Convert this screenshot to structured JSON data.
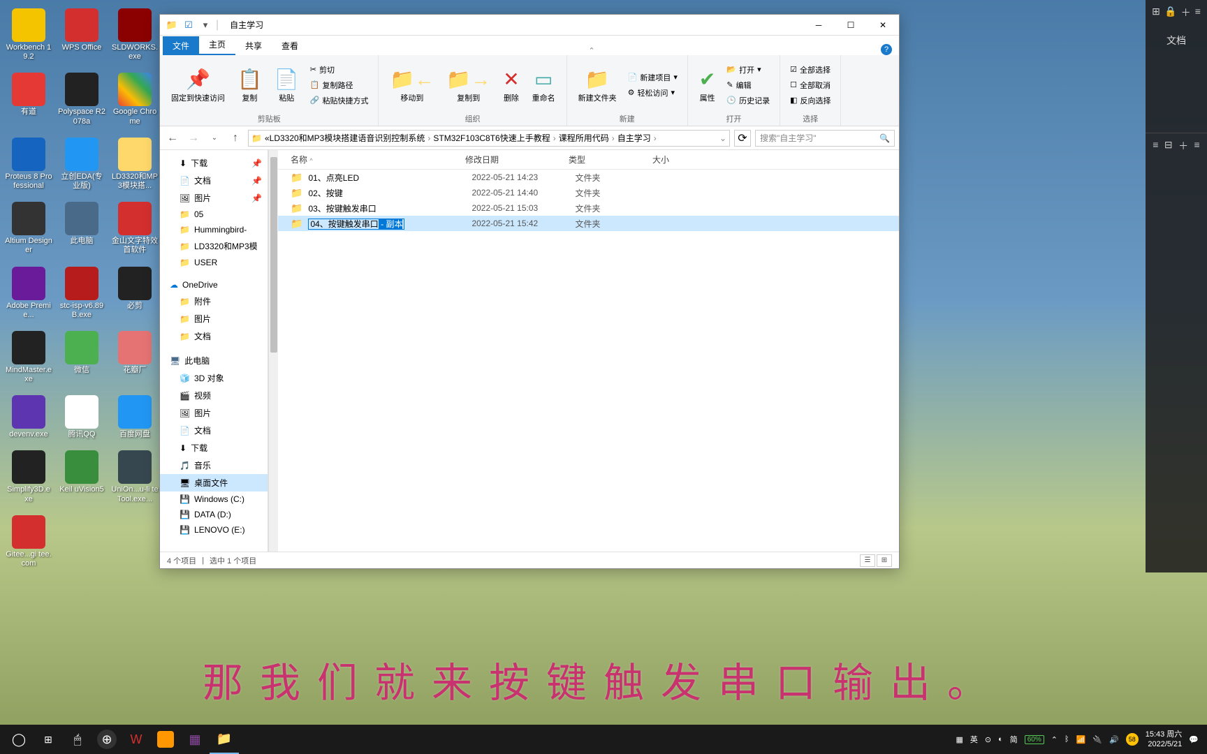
{
  "desktop": {
    "icons": [
      {
        "label": "Workbench 19.2",
        "bg": "#f5c400"
      },
      {
        "label": "WPS Office",
        "bg": "#d32f2f"
      },
      {
        "label": "SLDWORKS.exe",
        "bg": "#8b0000"
      },
      {
        "label": "有道",
        "bg": "#e53935"
      },
      {
        "label": "Polyspace R2078a",
        "bg": "#222"
      },
      {
        "label": "Google Chrome",
        "bg": "linear-gradient(45deg,#ea4335,#fbbc05,#34a853,#4285f4)"
      },
      {
        "label": "Proteus 8 Professional",
        "bg": "#1565c0"
      },
      {
        "label": "立创EDA(专业版)",
        "bg": "#2196f3"
      },
      {
        "label": "LD3320和MP3模块搭...",
        "bg": "#ffd86b"
      },
      {
        "label": "Altium Designer",
        "bg": "#333"
      },
      {
        "label": "此电脑",
        "bg": "#4a6a8a"
      },
      {
        "label": "金山文字特效首软件",
        "bg": "#d32f2f"
      },
      {
        "label": "Adobe Premie...",
        "bg": "#6a1b9a"
      },
      {
        "label": "stc-isp-v6.89B.exe",
        "bg": "#b71c1c"
      },
      {
        "label": "必剪",
        "bg": "#222"
      },
      {
        "label": "MindMaster.exe",
        "bg": "#222"
      },
      {
        "label": "微信",
        "bg": "#4caf50"
      },
      {
        "label": "花瓣厂",
        "bg": "#e57373"
      },
      {
        "label": "devenv.exe",
        "bg": "#5e35b1"
      },
      {
        "label": "腾讯QQ",
        "bg": "#fff"
      },
      {
        "label": "百度网盘",
        "bg": "#2196f3"
      },
      {
        "label": "Simplify3D.e xe",
        "bg": "#222"
      },
      {
        "label": "Keil uVision5",
        "bg": "#388e3c"
      },
      {
        "label": "UniOn...u-li teTool.exe...",
        "bg": "#37474f"
      },
      {
        "label": "Gitee...gi tee.com",
        "bg": "#d32f2f"
      }
    ]
  },
  "explorer": {
    "title": "自主学习",
    "tabs": {
      "file": "文件",
      "home": "主页",
      "share": "共享",
      "view": "查看"
    },
    "ribbon": {
      "clipboard": {
        "label": "剪贴板",
        "pin": "固定到快速访问",
        "copy": "复制",
        "paste": "粘贴",
        "cut": "剪切",
        "copypath": "复制路径",
        "pasteshortcut": "粘贴快捷方式"
      },
      "organize": {
        "label": "组织",
        "moveto": "移动到",
        "copyto": "复制到",
        "delete": "删除",
        "rename": "重命名"
      },
      "new": {
        "label": "新建",
        "newfolder": "新建文件夹",
        "newitem": "新建项目",
        "easyaccess": "轻松访问"
      },
      "open": {
        "label": "打开",
        "properties": "属性",
        "open": "打开",
        "edit": "编辑",
        "history": "历史记录"
      },
      "select": {
        "label": "选择",
        "selectall": "全部选择",
        "selectnone": "全部取消",
        "invert": "反向选择"
      }
    },
    "breadcrumb": [
      "LD3320和MP3模块搭建语音识别控制系统",
      "STM32F103C8T6快速上手教程",
      "课程所用代码",
      "自主学习"
    ],
    "search_placeholder": "搜索\"自主学习\"",
    "columns": {
      "name": "名称",
      "date": "修改日期",
      "type": "类型",
      "size": "大小"
    },
    "sidebar": {
      "quick": [
        {
          "label": "下载",
          "icon": "⬇",
          "pinned": true
        },
        {
          "label": "文档",
          "icon": "📄",
          "pinned": true
        },
        {
          "label": "图片",
          "icon": "🖼",
          "pinned": true
        },
        {
          "label": "05",
          "icon": "📁"
        },
        {
          "label": "Hummingbird-",
          "icon": "📁"
        },
        {
          "label": "LD3320和MP3模",
          "icon": "📁"
        },
        {
          "label": "USER",
          "icon": "📁"
        }
      ],
      "onedrive": "OneDrive",
      "onedrive_items": [
        {
          "label": "附件",
          "icon": "📁"
        },
        {
          "label": "图片",
          "icon": "📁"
        },
        {
          "label": "文档",
          "icon": "📁"
        }
      ],
      "thispc": "此电脑",
      "thispc_items": [
        {
          "label": "3D 对象",
          "icon": "🧊"
        },
        {
          "label": "视频",
          "icon": "🎬"
        },
        {
          "label": "图片",
          "icon": "🖼"
        },
        {
          "label": "文档",
          "icon": "📄"
        },
        {
          "label": "下载",
          "icon": "⬇"
        },
        {
          "label": "音乐",
          "icon": "🎵"
        },
        {
          "label": "桌面文件",
          "icon": "🖥",
          "selected": true
        },
        {
          "label": "Windows (C:)",
          "icon": "💾"
        },
        {
          "label": "DATA (D:)",
          "icon": "💾"
        },
        {
          "label": "LENOVO (E:)",
          "icon": "💾"
        }
      ]
    },
    "files": [
      {
        "name": "01、点亮LED",
        "date": "2022-05-21 14:23",
        "type": "文件夹"
      },
      {
        "name": "02、按键",
        "date": "2022-05-21 14:40",
        "type": "文件夹"
      },
      {
        "name": "03、按键触发串口",
        "date": "2022-05-21 15:03",
        "type": "文件夹"
      },
      {
        "name_prefix": "04、按键触发串口",
        "name_selected": " - 副本",
        "date": "2022-05-21 15:42",
        "type": "文件夹",
        "renaming": true
      }
    ],
    "status": {
      "items": "4 个项目",
      "selected": "选中 1 个项目"
    }
  },
  "right_panel": {
    "title": "文档"
  },
  "subtitle": "那我们就来按键触发串口输出。",
  "taskbar": {
    "ime": "英",
    "ime2": "简",
    "battery": "60%",
    "time": "15:43 周六",
    "date": "2022/5/21"
  }
}
